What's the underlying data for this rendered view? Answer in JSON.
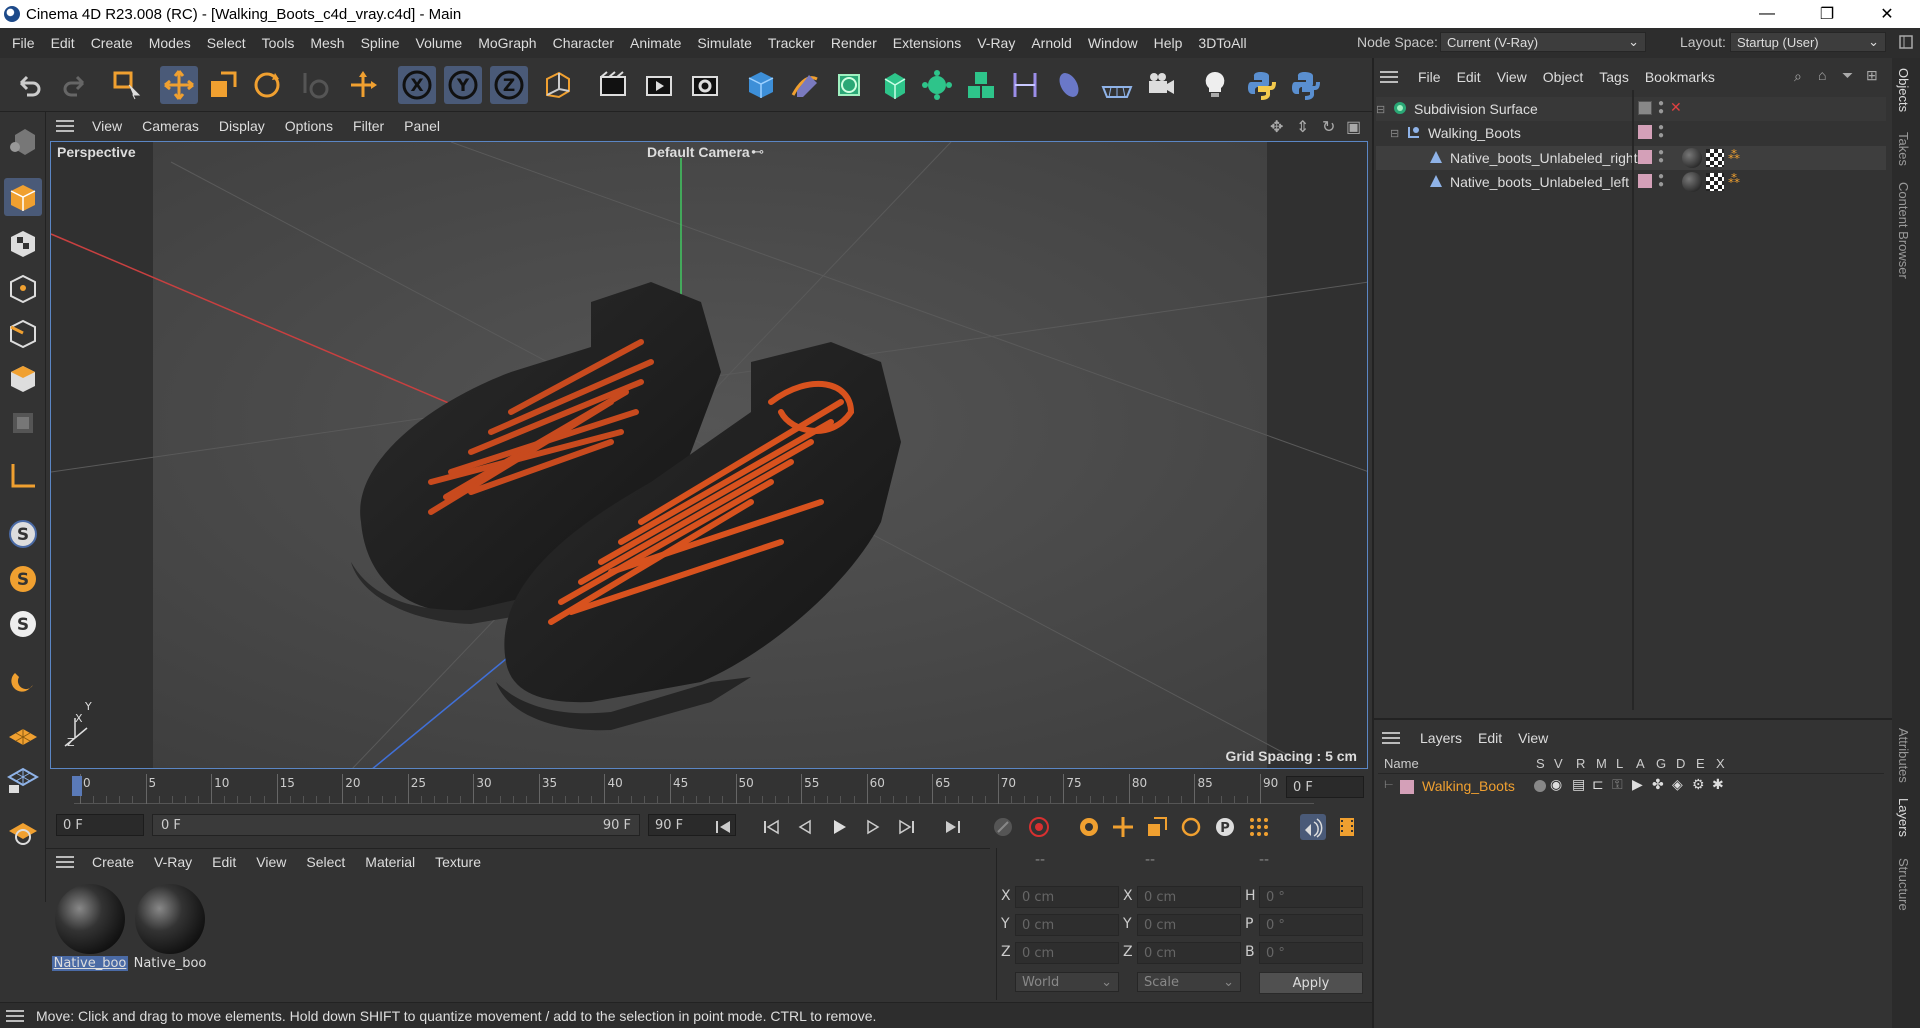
{
  "window": {
    "title": "Cinema 4D R23.008 (RC) - [Walking_Boots_c4d_vray.c4d] - Main",
    "minimize": "—",
    "maximize": "❐",
    "close": "✕"
  },
  "menubar": {
    "items": [
      "File",
      "Edit",
      "Create",
      "Modes",
      "Select",
      "Tools",
      "Mesh",
      "Spline",
      "Volume",
      "MoGraph",
      "Character",
      "Animate",
      "Simulate",
      "Tracker",
      "Render",
      "Extensions",
      "V-Ray",
      "Arnold",
      "Window",
      "Help",
      "3DToAll"
    ],
    "node_space_label": "Node Space:",
    "node_space_value": "Current (V-Ray)",
    "layout_label": "Layout:",
    "layout_value": "Startup (User)"
  },
  "viewport": {
    "menu": [
      "View",
      "Cameras",
      "Display",
      "Options",
      "Filter",
      "Panel"
    ],
    "label_perspective": "Perspective",
    "label_camera": "Default Camera",
    "grid_spacing": "Grid Spacing : 5 cm",
    "axis_x": "X",
    "axis_y": "Y",
    "axis_z": "Z"
  },
  "timeline": {
    "ticks": [
      "0",
      "5",
      "10",
      "15",
      "20",
      "25",
      "30",
      "35",
      "40",
      "45",
      "50",
      "55",
      "60",
      "65",
      "70",
      "75",
      "80",
      "85",
      "90"
    ],
    "current_frame": "0 F",
    "start_frame": "0 F",
    "range_start": "0 F",
    "range_end": "90 F",
    "end_frame": "90 F"
  },
  "materials": {
    "menu": [
      "Create",
      "V-Ray",
      "Edit",
      "View",
      "Select",
      "Material",
      "Texture"
    ],
    "items": [
      {
        "label": "Native_boo"
      },
      {
        "label": "Native_boo"
      }
    ]
  },
  "coordinates": {
    "headers": [
      "--",
      "--",
      "--"
    ],
    "rows": [
      {
        "l1": "X",
        "v1": "0 cm",
        "l2": "X",
        "v2": "0 cm",
        "l3": "H",
        "v3": "0 °"
      },
      {
        "l1": "Y",
        "v1": "0 cm",
        "l2": "Y",
        "v2": "0 cm",
        "l3": "P",
        "v3": "0 °"
      },
      {
        "l1": "Z",
        "v1": "0 cm",
        "l2": "Z",
        "v2": "0 cm",
        "l3": "B",
        "v3": "0 °"
      }
    ],
    "space": "World",
    "mode": "Scale",
    "apply": "Apply"
  },
  "status": {
    "text": "Move: Click and drag to move elements. Hold down SHIFT to quantize movement / add to the selection in point mode. CTRL to remove."
  },
  "objects": {
    "menu": [
      "File",
      "Edit",
      "View",
      "Object",
      "Tags",
      "Bookmarks"
    ],
    "tree": [
      {
        "name": "Subdivision Surface"
      },
      {
        "name": "Walking_Boots"
      },
      {
        "name": "Native_boots_Unlabeled_right"
      },
      {
        "name": "Native_boots_Unlabeled_left"
      }
    ]
  },
  "layers": {
    "menu": [
      "Layers",
      "Edit",
      "View"
    ],
    "col_name": "Name",
    "cols": [
      "S",
      "V",
      "R",
      "M",
      "L",
      "A",
      "G",
      "D",
      "E",
      "X"
    ],
    "rows": [
      {
        "name": "Walking_Boots"
      }
    ]
  },
  "side_tabs": [
    "Objects",
    "Takes",
    "Content Browser",
    "Attributes",
    "Layers",
    "Structure"
  ],
  "colors": {
    "accent_orange": "#f0a030",
    "selection_blue": "#4a6aa5",
    "layer_name": "#f0a030"
  }
}
